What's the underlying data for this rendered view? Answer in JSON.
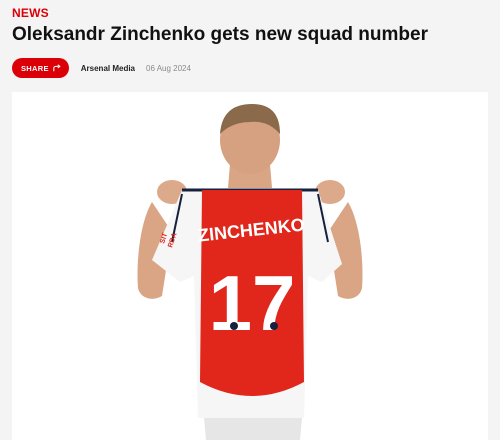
{
  "article": {
    "category": "NEWS",
    "title": "Oleksandr Zinchenko gets new squad number",
    "share_label": "SHARE",
    "author": "Arsenal Media",
    "date": "06 Aug 2024"
  },
  "image": {
    "jersey_name": "ZINCHENKO",
    "jersey_number": "17",
    "sleeve_text_line1": "SIT",
    "sleeve_text_line2": "RDA"
  },
  "colors": {
    "accent": "#db0007",
    "jersey_red": "#e1261c",
    "navy": "#16213e"
  }
}
